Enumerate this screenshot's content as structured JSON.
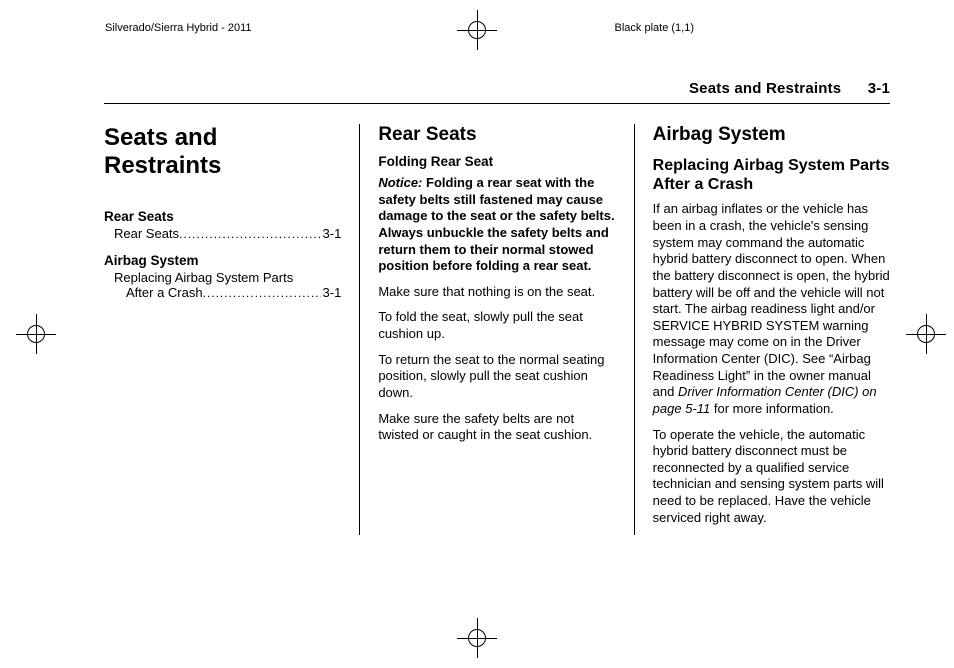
{
  "topbar": {
    "left": "Silverado/Sierra Hybrid - 2011",
    "right": "Black plate (1,1)"
  },
  "header": {
    "section": "Seats and Restraints",
    "pagenum": "3-1"
  },
  "col1": {
    "chapter": "Seats and Restraints",
    "toc": {
      "h1": "Rear Seats",
      "l1_label": "Rear Seats",
      "l1_pg": "3-1",
      "h2": "Airbag System",
      "l2a": "Replacing Airbag System Parts",
      "l2b": "After a Crash",
      "l2_pg": "3-1"
    }
  },
  "col2": {
    "h": "Rear Seats",
    "sub": "Folding Rear Seat",
    "notice_label": "Notice:",
    "notice": "Folding a rear seat with the safety belts still fastened may cause damage to the seat or the safety belts. Always unbuckle the safety belts and return them to their normal stowed position before folding a rear seat.",
    "p1": "Make sure that nothing is on the seat.",
    "p2": "To fold the seat, slowly pull the seat cushion up.",
    "p3": "To return the seat to the normal seating position, slowly pull the seat cushion down.",
    "p4": "Make sure the safety belts are not twisted or caught in the seat cushion."
  },
  "col3": {
    "h": "Airbag System",
    "sub": "Replacing Airbag System Parts After a Crash",
    "p1a": "If an airbag inflates or the vehicle has been in a crash, the vehicle's sensing system may command the automatic hybrid battery disconnect to open. When the battery disconnect is open, the hybrid battery will be off and the vehicle will not start. The airbag readiness light and/or SERVICE HYBRID SYSTEM warning message may come on in the Driver Information Center (DIC). See “Airbag Readiness Light” in the owner manual and ",
    "p1i": "Driver Information Center (DIC) on page 5-11",
    "p1b": " for more information.",
    "p2": "To operate the vehicle, the automatic hybrid battery disconnect must be reconnected by a qualified service technician and sensing system parts will need to be replaced. Have the vehicle serviced right away."
  }
}
